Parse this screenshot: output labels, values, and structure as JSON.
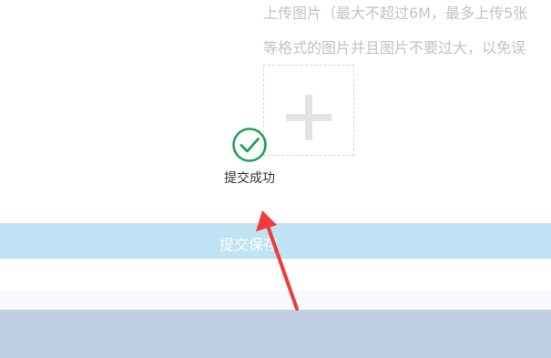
{
  "upload": {
    "hint_line_1": "上传图片（最大不超过6M，最多上传5张",
    "hint_line_2": "等格式的图片并且图片不要过大，以免误",
    "add_icon": "plus-icon"
  },
  "toast": {
    "icon": "check-circle-icon",
    "message": "提交成功"
  },
  "submit": {
    "label": "提交保存"
  },
  "annotation": {
    "icon": "red-arrow-icon"
  },
  "colors": {
    "success_green": "#1fa15a",
    "submit_bar": "#bfe2f4",
    "footer_bar": "#bfd0e4",
    "arrow_red": "#ef3b3b",
    "hint_text": "#c3c3c3"
  }
}
